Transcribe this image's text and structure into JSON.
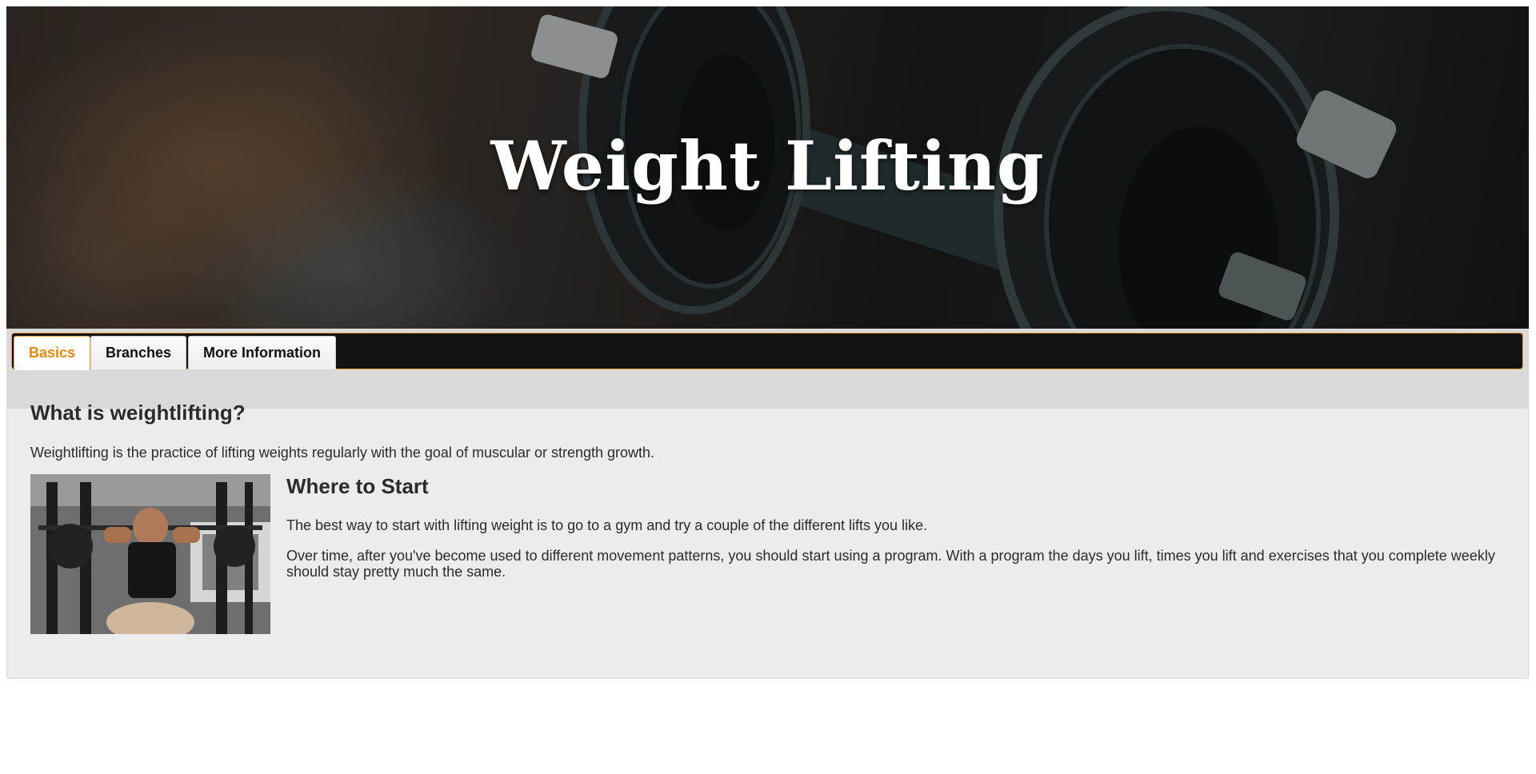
{
  "header": {
    "title": "Weight Lifting"
  },
  "tabs": [
    {
      "label": "Basics",
      "active": true
    },
    {
      "label": "Branches",
      "active": false
    },
    {
      "label": "More Information",
      "active": false
    }
  ],
  "basics": {
    "heading": "What is weightlifting?",
    "intro": "Weightlifting is the practice of lifting weights regularly with the goal of muscular or strength growth.",
    "start_heading": "Where to Start",
    "start_paragraph_1": "The best way to start with lifting weight is to go to a gym and try a couple of the different lifts you like.",
    "start_paragraph_2": "Over time, after you've become used to different movement patterns, you should start using a program. With a program the days you lift, times you lift and exercises that you complete weekly should stay pretty much the same."
  },
  "colors": {
    "accent": "#e8890c",
    "tabbar": "#121212",
    "panel": "#ececec"
  }
}
